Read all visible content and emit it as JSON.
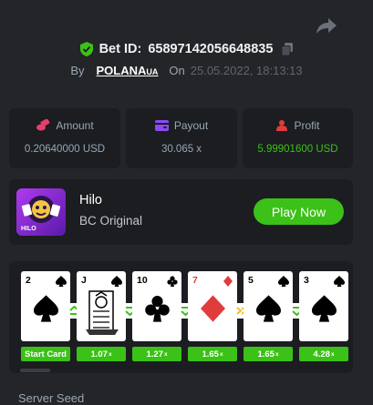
{
  "bet": {
    "id_label": "Bet ID:",
    "id_value": "65897142056648835",
    "by_label": "By",
    "user_name": "POLANA",
    "user_suffix": "UA",
    "on_label": "On",
    "date": "25.05.2022, 18:13:13"
  },
  "stats": {
    "amount_label": "Amount",
    "amount_value": "0.20640000 USD",
    "payout_label": "Payout",
    "payout_value": "30.065 x",
    "profit_label": "Profit",
    "profit_value": "5.99901600 USD"
  },
  "game": {
    "name": "Hilo",
    "provider": "BC Original",
    "logo_text": "HILO",
    "play_label": "Play Now"
  },
  "rounds": {
    "cards": [
      {
        "rank": "2",
        "suit": "spade"
      },
      {
        "rank": "J",
        "suit": "spade"
      },
      {
        "rank": "10",
        "suit": "club"
      },
      {
        "rank": "7",
        "suit": "diamond"
      },
      {
        "rank": "5",
        "suit": "spade"
      },
      {
        "rank": "3",
        "suit": "spade"
      }
    ],
    "moves": [
      "higher",
      "lower",
      "lower",
      "skip",
      "lower"
    ],
    "tags": [
      {
        "text": "Start Card",
        "unit": ""
      },
      {
        "text": "1.07",
        "unit": "x"
      },
      {
        "text": "1.27",
        "unit": "x"
      },
      {
        "text": "1.65",
        "unit": "x"
      },
      {
        "text": "1.65",
        "unit": "x"
      },
      {
        "text": "4.28",
        "unit": "x"
      }
    ]
  },
  "footer": {
    "server_seed_label": "Server Seed"
  },
  "colors": {
    "background": "#232529",
    "panel": "#1b1d21",
    "accent_green": "#3bc117",
    "muted_text": "#98a7b5",
    "payout_icon": "#8c4af4",
    "profit_icon": "#e03c3c",
    "amount_icon": "#e83e6a"
  },
  "icons": {
    "share": "share-icon",
    "verified": "shield-check-icon",
    "copy": "copy-icon",
    "amount": "coins-icon",
    "payout": "wallet-icon",
    "profit": "money-bag-icon"
  }
}
